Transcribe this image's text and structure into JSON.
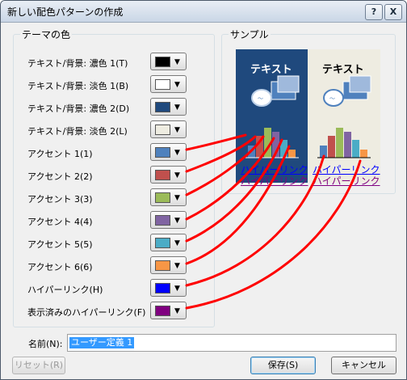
{
  "window": {
    "title": "新しい配色パターンの作成",
    "help_glyph": "?",
    "close_glyph": "X"
  },
  "theme_colors": {
    "group_label": "テーマの色",
    "rows": [
      {
        "label": "テキスト/背景: 濃色 1(T)",
        "color": "#000000"
      },
      {
        "label": "テキスト/背景: 淡色 1(B)",
        "color": "#ffffff"
      },
      {
        "label": "テキスト/背景: 濃色 2(D)",
        "color": "#1f497d"
      },
      {
        "label": "テキスト/背景: 淡色 2(L)",
        "color": "#eeece1"
      },
      {
        "label": "アクセント 1(1)",
        "color": "#4f81bd"
      },
      {
        "label": "アクセント 2(2)",
        "color": "#c0504d"
      },
      {
        "label": "アクセント 3(3)",
        "color": "#9bbb59"
      },
      {
        "label": "アクセント 4(4)",
        "color": "#8064a2"
      },
      {
        "label": "アクセント 5(5)",
        "color": "#4bacc6"
      },
      {
        "label": "アクセント 6(6)",
        "color": "#f79646"
      },
      {
        "label": "ハイパーリンク(H)",
        "color": "#0000ff"
      },
      {
        "label": "表示済みのハイパーリンク(F)",
        "color": "#800080"
      }
    ]
  },
  "sample": {
    "group_label": "サンプル",
    "dark_panel": {
      "text": "テキスト",
      "link": "ハイパーリンク",
      "visited_link": "ハイパーリンク"
    },
    "light_panel": {
      "text": "テキスト",
      "link": "ハイパーリンク",
      "visited_link": "ハイパーリンク"
    }
  },
  "name_field": {
    "label": "名前(N):",
    "value": "ユーザー定義 1"
  },
  "buttons": {
    "reset": "リセット(R)",
    "save": "保存(S)",
    "cancel": "キャンセル"
  }
}
